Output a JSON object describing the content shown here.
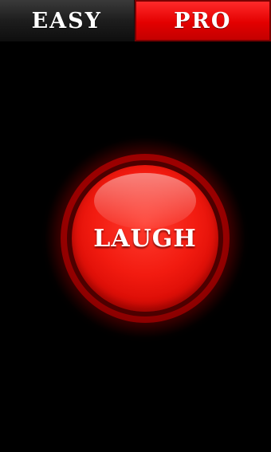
{
  "tabs": {
    "easy_label": "EASY",
    "pro_label": "PRO",
    "selected": "PRO"
  },
  "main_button": {
    "label": "LAUGH"
  },
  "colors": {
    "background": "#000000",
    "accent_red": "#e30000",
    "tab_dark": "#1d1d1d"
  }
}
